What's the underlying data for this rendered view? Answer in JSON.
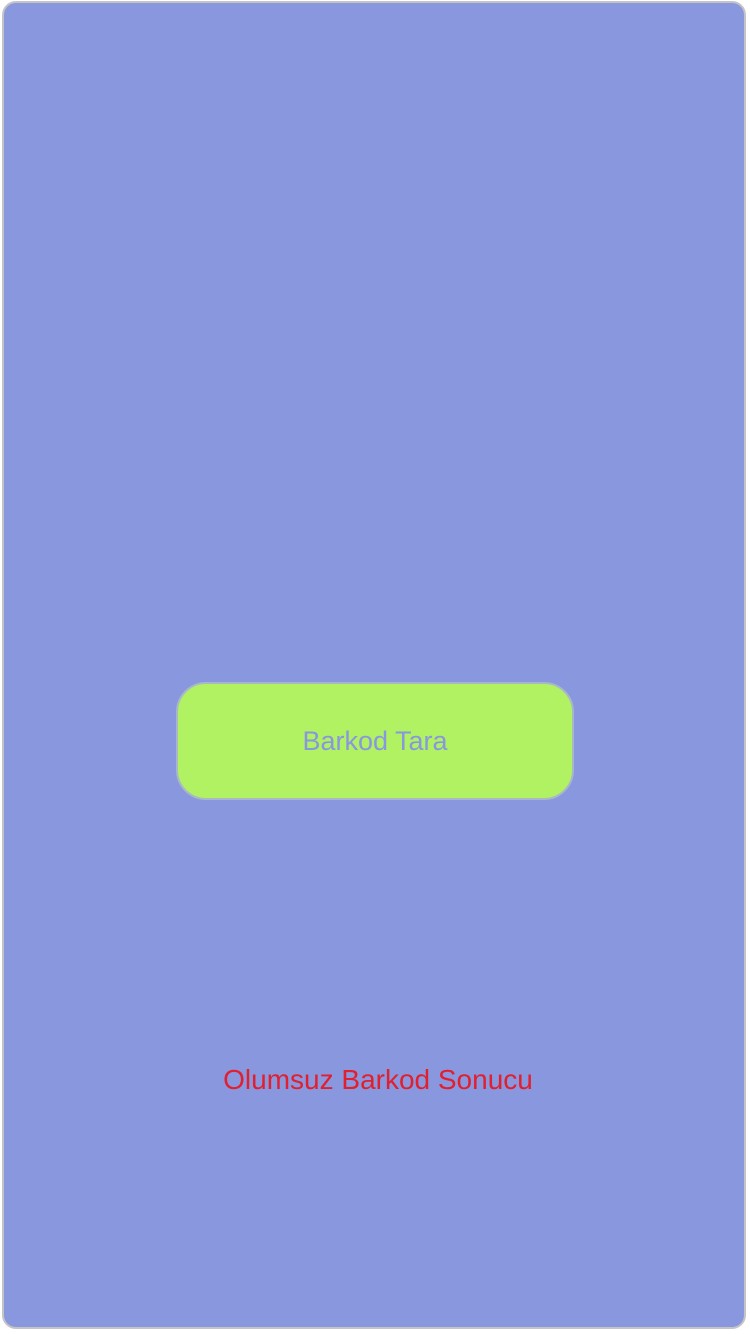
{
  "scan_button": {
    "label": "Barkod Tara"
  },
  "result": {
    "text": "Olumsuz Barkod Sonucu"
  },
  "colors": {
    "background": "#8997de",
    "button": "#b0f262",
    "result_text": "#e0202f"
  }
}
